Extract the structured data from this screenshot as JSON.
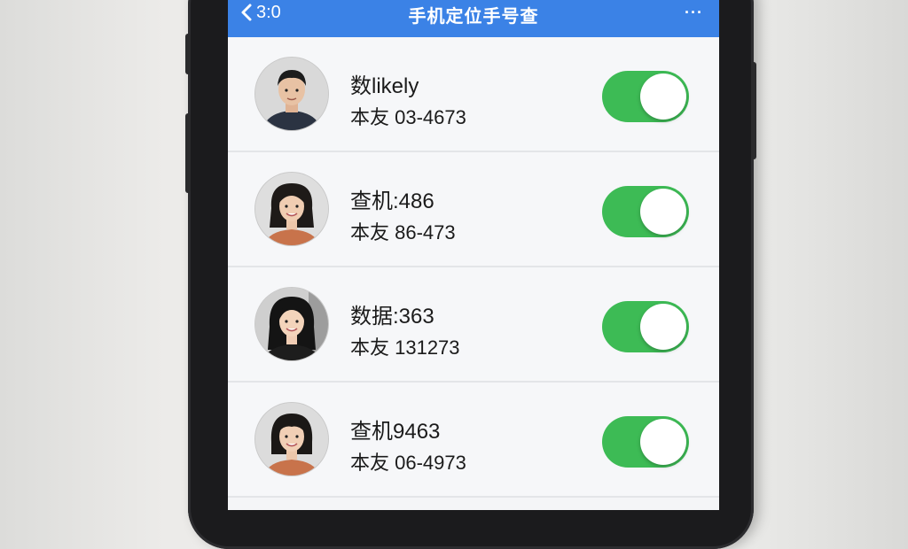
{
  "header": {
    "back_label": "3:0",
    "title": "手机定位手号查",
    "more_label": "···",
    "color": "#3b82e6"
  },
  "contacts": [
    {
      "name": "数likely",
      "number": "本友 03-4673",
      "toggle_on": true
    },
    {
      "name": "查机:486",
      "number": "本友 86-473",
      "toggle_on": true
    },
    {
      "name": "数据:363",
      "number": "本友 131273",
      "toggle_on": true
    },
    {
      "name": "查机9463",
      "number": "本友 06-4973",
      "toggle_on": true
    }
  ],
  "toggle_color": "#3dbb55"
}
